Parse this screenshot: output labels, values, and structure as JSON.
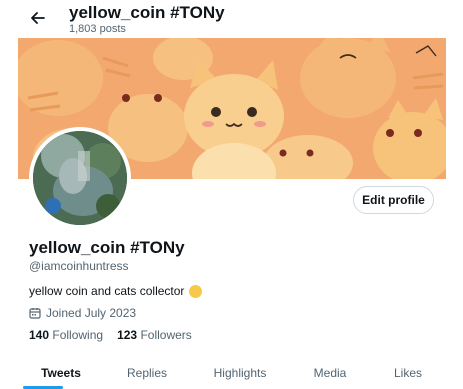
{
  "header": {
    "title": "yellow_coin #TONy",
    "posts_count": "1,803 posts",
    "back_icon": "arrow-left-icon"
  },
  "profile": {
    "edit_button": "Edit profile",
    "display_name": "yellow_coin #TONy",
    "handle": "@iamcoinhuntress",
    "bio": "yellow coin and cats collector",
    "bio_emoji_color": "#f7c948",
    "joined": "Joined July 2023",
    "following_count": "140",
    "following_label": "Following",
    "followers_count": "123",
    "followers_label": "Followers"
  },
  "tabs": [
    {
      "label": "Tweets",
      "active": true
    },
    {
      "label": "Replies",
      "active": false
    },
    {
      "label": "Highlights",
      "active": false
    },
    {
      "label": "Media",
      "active": false
    },
    {
      "label": "Likes",
      "active": false
    }
  ],
  "colors": {
    "accent": "#1d9bf0",
    "banner_bg": "#f2a86f",
    "cat_fur": "#f7c27a",
    "text_secondary": "#536471"
  }
}
